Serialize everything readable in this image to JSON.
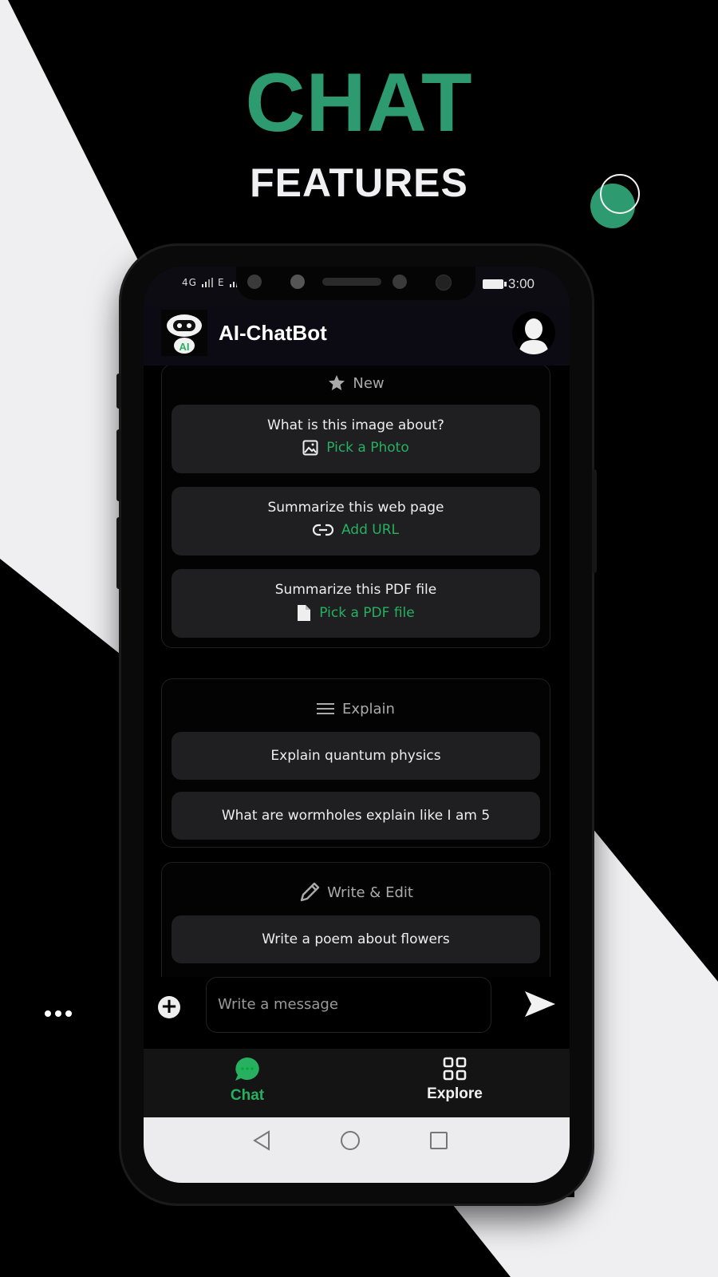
{
  "promo": {
    "headline": "CHAT",
    "subheadline": "FEATURES",
    "accent_color": "#2e9a6f"
  },
  "status_bar": {
    "signal_1": "4G",
    "signal_2": "E",
    "time": "3:00"
  },
  "app_bar": {
    "logo_text": "AI",
    "title": "AI-ChatBot"
  },
  "sections": [
    {
      "title": "New",
      "icon": "star-icon",
      "cards": [
        {
          "prompt": "What is this image about?",
          "action_icon": "image-icon",
          "action_label": "Pick a Photo"
        },
        {
          "prompt": "Summarize this web page",
          "action_icon": "link-icon",
          "action_label": "Add URL"
        },
        {
          "prompt": "Summarize this PDF file",
          "action_icon": "file-icon",
          "action_label": "Pick a PDF file"
        }
      ]
    },
    {
      "title": "Explain",
      "icon": "menu-lines-icon",
      "cards": [
        {
          "prompt": "Explain quantum physics"
        },
        {
          "prompt": "What are wormholes explain like I am 5"
        }
      ]
    },
    {
      "title": "Write & Edit",
      "icon": "pencil-icon",
      "cards": [
        {
          "prompt": "Write a poem about flowers"
        }
      ]
    }
  ],
  "composer": {
    "placeholder": "Write a message"
  },
  "bottom_nav": {
    "items": [
      {
        "label": "Chat",
        "icon": "chat-bubble-icon",
        "active": true
      },
      {
        "label": "Explore",
        "icon": "grid-icon",
        "active": false
      }
    ],
    "active_color": "#27b060"
  }
}
